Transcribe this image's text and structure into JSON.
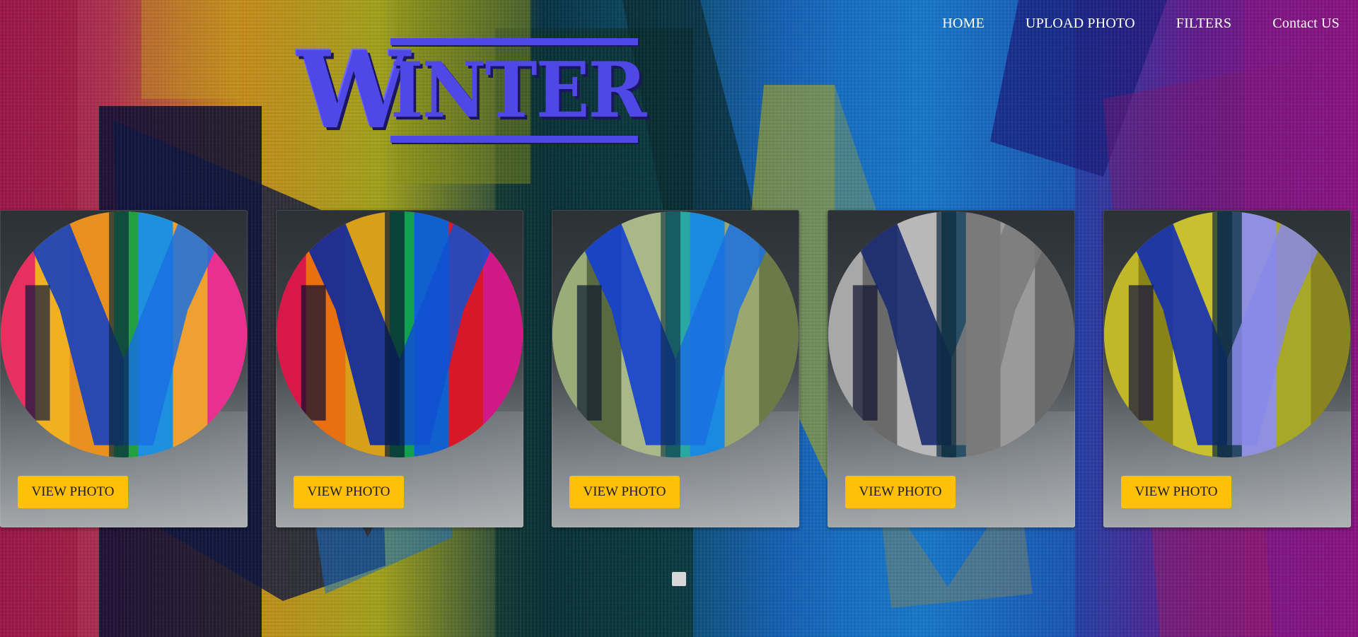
{
  "nav": {
    "items": [
      {
        "label": "HOME"
      },
      {
        "label": "UPLOAD PHOTO"
      },
      {
        "label": "FILTERS"
      },
      {
        "label": "Contact US"
      }
    ]
  },
  "logo": {
    "first_letter": "W",
    "rest": "INTER"
  },
  "cards": [
    {
      "filter": "original",
      "button_label": "VIEW PHOTO"
    },
    {
      "filter": "saturated",
      "button_label": "VIEW PHOTO"
    },
    {
      "filter": "olive",
      "button_label": "VIEW PHOTO"
    },
    {
      "filter": "grayscale",
      "button_label": "VIEW PHOTO"
    },
    {
      "filter": "yellow-lavender",
      "button_label": "VIEW PHOTO"
    }
  ],
  "colors": {
    "button": "#ffc107",
    "logo": "#5048e6",
    "nav_text": "#ffffff",
    "pagination_dot": "#d7d7d7"
  }
}
